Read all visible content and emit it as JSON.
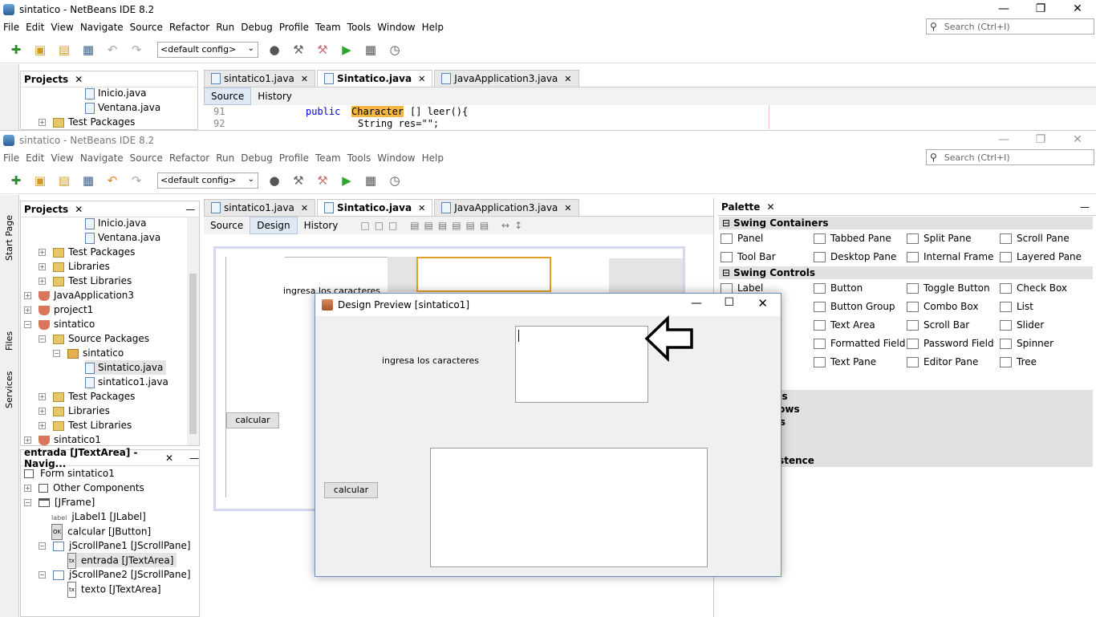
{
  "back_window": {
    "title": "sintatico - NetBeans IDE 8.2",
    "menu": [
      "File",
      "Edit",
      "View",
      "Navigate",
      "Source",
      "Refactor",
      "Run",
      "Debug",
      "Profile",
      "Team",
      "Tools",
      "Window",
      "Help"
    ],
    "search_placeholder": "Search (Ctrl+I)",
    "config": "<default config>",
    "projects_title": "Projects",
    "tree": [
      "Inicio.java",
      "Ventana.java",
      "Test Packages"
    ],
    "tabs": [
      "sintatico1.java",
      "Sintatico.java",
      "JavaApplication3.java"
    ],
    "subtabs": [
      "Source",
      "History"
    ],
    "code_line_91": "91",
    "code_line_92": "92",
    "code_keyword": "public",
    "code_type": "Character",
    "code_rest": "[] leer(){",
    "code_next": "String res=\"\";"
  },
  "front_window": {
    "title": "sintatico - NetBeans IDE 8.2",
    "menu": [
      "File",
      "Edit",
      "View",
      "Navigate",
      "Source",
      "Refactor",
      "Run",
      "Debug",
      "Profile",
      "Team",
      "Tools",
      "Window",
      "Help"
    ],
    "search_placeholder": "Search (Ctrl+I)",
    "config": "<default config>",
    "side_tabs": [
      "Start Page",
      "Files",
      "Services"
    ],
    "projects_title": "Projects",
    "project_tree": [
      "Inicio.java",
      "Ventana.java",
      "Test Packages",
      "Libraries",
      "Test Libraries",
      "JavaApplication3",
      "project1",
      "sintatico",
      "Source Packages",
      "sintatico",
      "Sintatico.java",
      "sintatico1.java",
      "Test Packages",
      "Libraries",
      "Test Libraries",
      "sintatico1"
    ],
    "navigator_title": "entrada [JTextArea] - Navig...",
    "navigator_tree": [
      "Form sintatico1",
      "Other Components",
      "[JFrame]",
      "jLabel1 [JLabel]",
      "calcular [JButton]",
      "jScrollPane1 [JScrollPane]",
      "entrada [JTextArea]",
      "jScrollPane2 [JScrollPane]",
      "texto [JTextArea]"
    ],
    "editor_tabs": [
      "sintatico1.java",
      "Sintatico.java",
      "JavaApplication3.java"
    ],
    "editor_subtabs": [
      "Source",
      "Design",
      "History"
    ],
    "form_label": "ingresa los caracteres",
    "form_button": "calcular",
    "palette_title": "Palette",
    "palette_categories": [
      "Swing Containers",
      "Swing Controls",
      "us",
      "lows",
      "rs",
      "istence"
    ],
    "swing_containers": [
      "Panel",
      "Tabbed Pane",
      "Split Pane",
      "Scroll Pane",
      "Tool Bar",
      "Desktop Pane",
      "Internal Frame",
      "Layered Pane"
    ],
    "swing_controls": [
      "Label",
      "Button",
      "Toggle Button",
      "Check Box",
      "n",
      "Button Group",
      "Combo Box",
      "List",
      "Text Area",
      "Scroll Bar",
      "Slider",
      "r",
      "Formatted Field",
      "Password Field",
      "Spinner",
      "Text Pane",
      "Editor Pane",
      "Tree"
    ]
  },
  "preview": {
    "title": "Design Preview [sintatico1]",
    "label": "ingresa los caracteres",
    "button": "calcular"
  }
}
